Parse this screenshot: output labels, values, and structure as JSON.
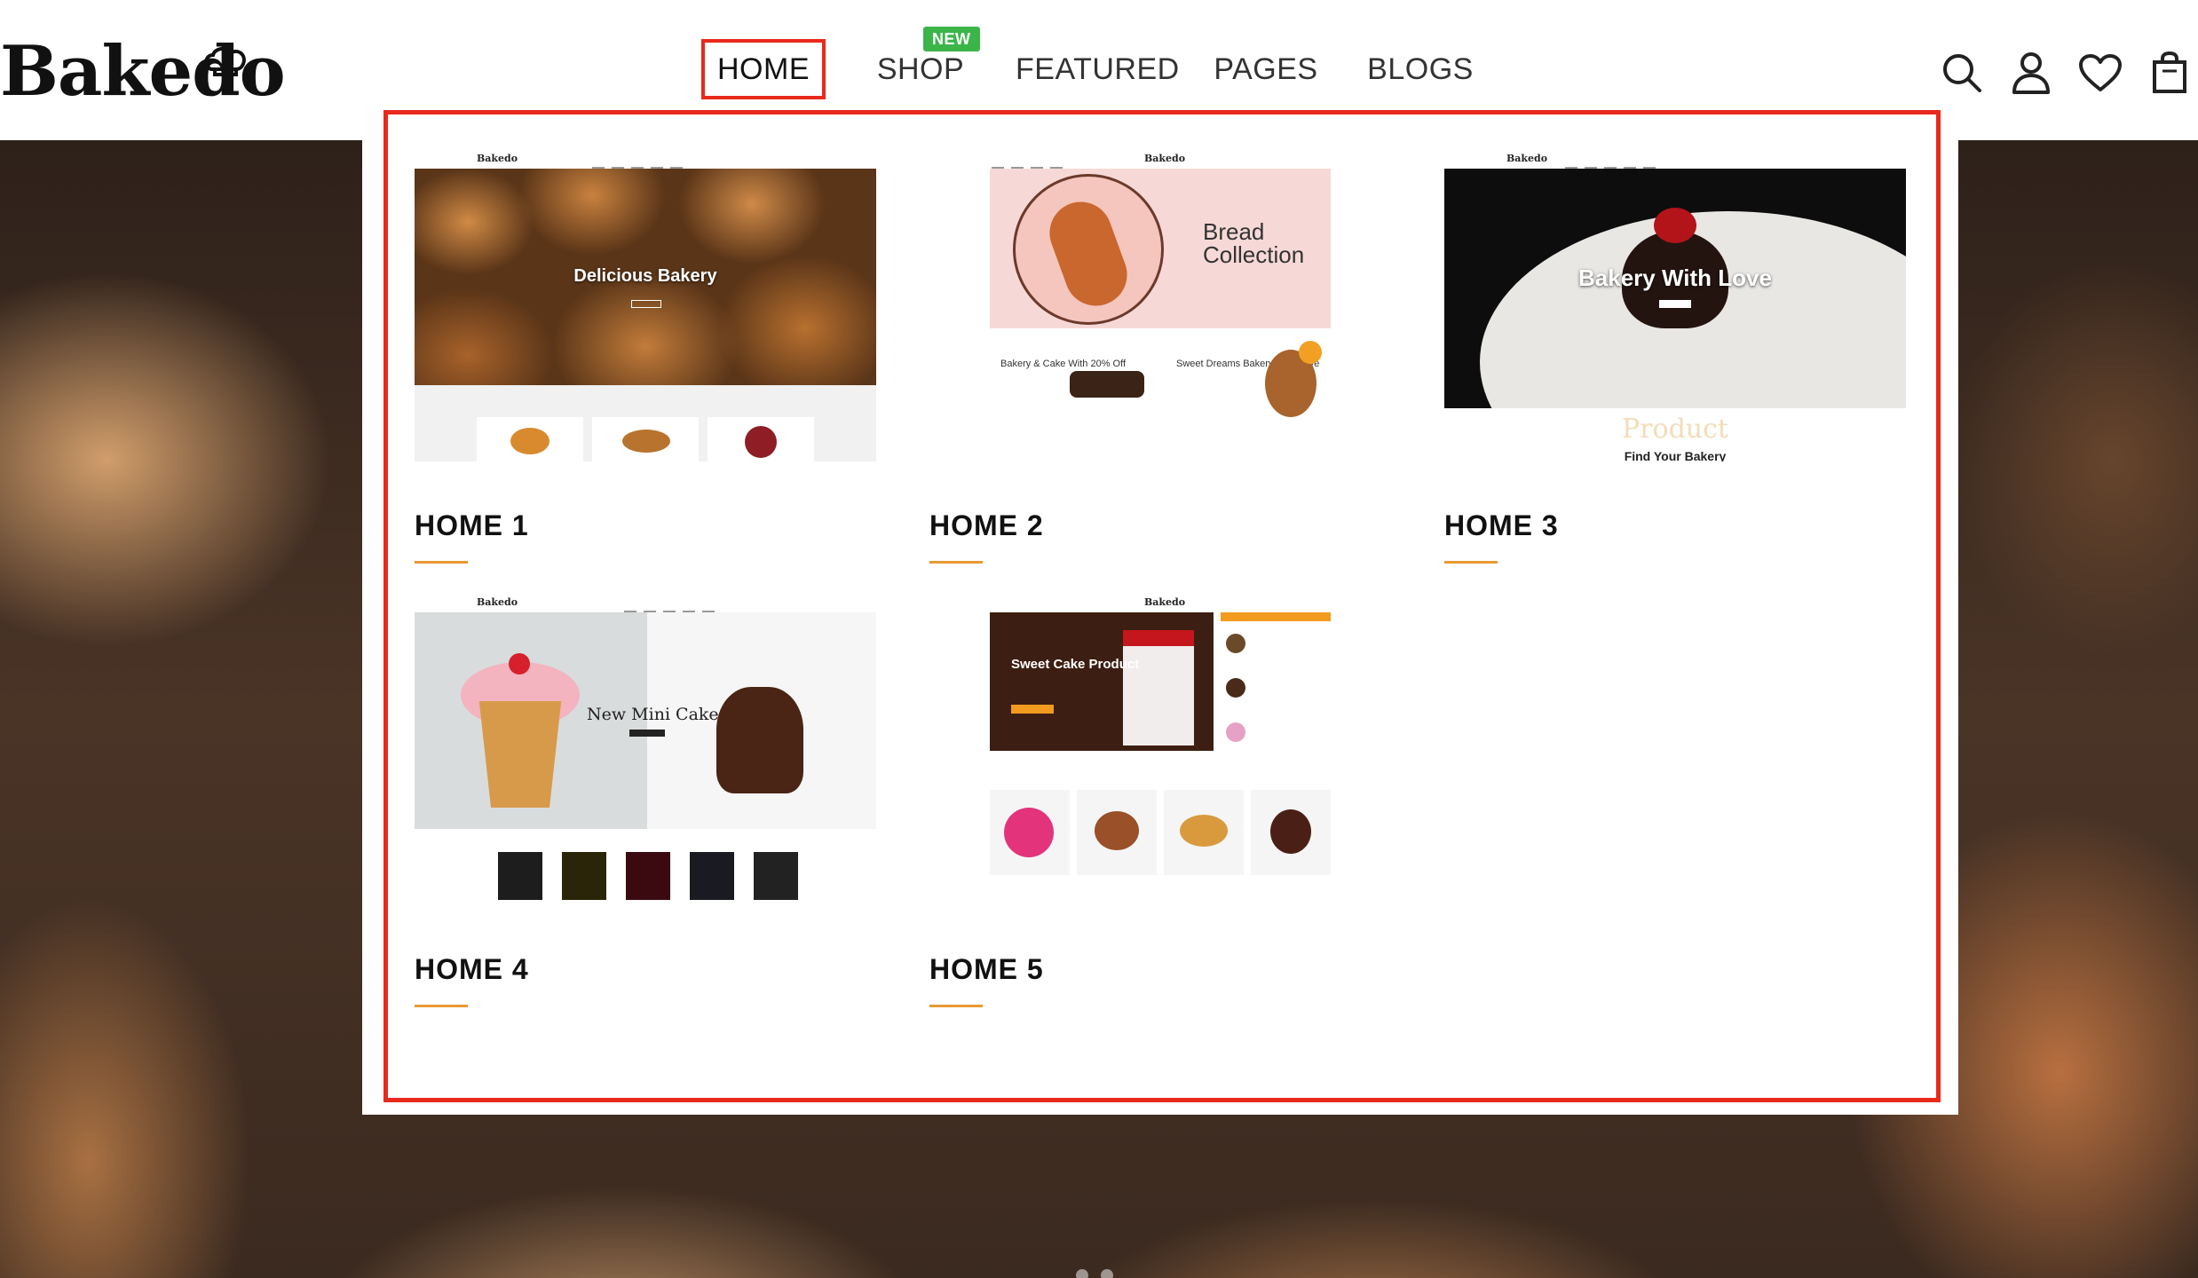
{
  "brand": {
    "logo_text": "Bakedo"
  },
  "nav": {
    "items": [
      {
        "label": "HOME"
      },
      {
        "label": "SHOP",
        "badge": "NEW"
      },
      {
        "label": "FEATURED"
      },
      {
        "label": "PAGES"
      },
      {
        "label": "BLOGS"
      }
    ],
    "active": "HOME"
  },
  "header_icons": [
    "search-icon",
    "user-icon",
    "heart-icon",
    "shopping-bag-icon"
  ],
  "mega_menu": {
    "demos": [
      {
        "title": "HOME 1",
        "thumb_heading": "Delicious Bakery"
      },
      {
        "title": "HOME 2",
        "thumb_heading": "Bread Collection",
        "thumb_sub_1": "Bakery & Cake With 20% Off",
        "thumb_sub_2": "Sweet Dreams Bakery With Love"
      },
      {
        "title": "HOME 3",
        "thumb_heading": "Bakery With Love",
        "thumb_sub_1": "Product",
        "thumb_sub_2": "Find Your Bakery"
      },
      {
        "title": "HOME 4",
        "thumb_heading": "New Mini Cake"
      },
      {
        "title": "HOME 5",
        "thumb_heading": "Sweet Cake Product"
      }
    ]
  },
  "colors": {
    "highlight": "#e8291c",
    "accent": "#e89a33",
    "badge": "#3bb54a"
  }
}
